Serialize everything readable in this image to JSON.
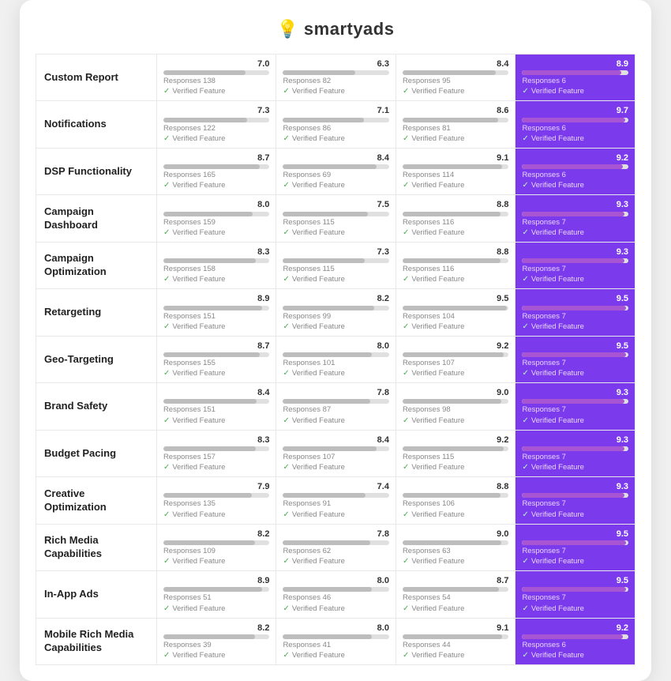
{
  "logo": {
    "text": "smartyads",
    "icon": "💡"
  },
  "rows": [
    {
      "label": "Custom Report",
      "cols": [
        {
          "score": "7.0",
          "responses": "138",
          "pct": 77
        },
        {
          "score": "6.3",
          "responses": "82",
          "pct": 68
        },
        {
          "score": "8.4",
          "responses": "95",
          "pct": 88
        },
        {
          "score": "8.9",
          "responses": "6",
          "pct": 93,
          "purple": true
        }
      ]
    },
    {
      "label": "Notifications",
      "cols": [
        {
          "score": "7.3",
          "responses": "122",
          "pct": 79
        },
        {
          "score": "7.1",
          "responses": "86",
          "pct": 76
        },
        {
          "score": "8.6",
          "responses": "81",
          "pct": 90
        },
        {
          "score": "9.7",
          "responses": "6",
          "pct": 97,
          "purple": true
        }
      ]
    },
    {
      "label": "DSP Functionality",
      "cols": [
        {
          "score": "8.7",
          "responses": "165",
          "pct": 91
        },
        {
          "score": "8.4",
          "responses": "69",
          "pct": 88
        },
        {
          "score": "9.1",
          "responses": "114",
          "pct": 94
        },
        {
          "score": "9.2",
          "responses": "6",
          "pct": 95,
          "purple": true
        }
      ]
    },
    {
      "label": "Campaign Dashboard",
      "cols": [
        {
          "score": "8.0",
          "responses": "159",
          "pct": 84
        },
        {
          "score": "7.5",
          "responses": "115",
          "pct": 80
        },
        {
          "score": "8.8",
          "responses": "116",
          "pct": 92
        },
        {
          "score": "9.3",
          "responses": "7",
          "pct": 96,
          "purple": true
        }
      ]
    },
    {
      "label": "Campaign Optimization",
      "cols": [
        {
          "score": "8.3",
          "responses": "158",
          "pct": 87
        },
        {
          "score": "7.3",
          "responses": "115",
          "pct": 77
        },
        {
          "score": "8.8",
          "responses": "116",
          "pct": 92
        },
        {
          "score": "9.3",
          "responses": "7",
          "pct": 96,
          "purple": true
        }
      ]
    },
    {
      "label": "Retargeting",
      "cols": [
        {
          "score": "8.9",
          "responses": "151",
          "pct": 93
        },
        {
          "score": "8.2",
          "responses": "99",
          "pct": 86
        },
        {
          "score": "9.5",
          "responses": "104",
          "pct": 98
        },
        {
          "score": "9.5",
          "responses": "7",
          "pct": 98,
          "purple": true
        }
      ]
    },
    {
      "label": "Geo-Targeting",
      "cols": [
        {
          "score": "8.7",
          "responses": "155",
          "pct": 91
        },
        {
          "score": "8.0",
          "responses": "101",
          "pct": 84
        },
        {
          "score": "9.2",
          "responses": "107",
          "pct": 95
        },
        {
          "score": "9.5",
          "responses": "7",
          "pct": 98,
          "purple": true
        }
      ]
    },
    {
      "label": "Brand Safety",
      "cols": [
        {
          "score": "8.4",
          "responses": "151",
          "pct": 88
        },
        {
          "score": "7.8",
          "responses": "87",
          "pct": 82
        },
        {
          "score": "9.0",
          "responses": "98",
          "pct": 93
        },
        {
          "score": "9.3",
          "responses": "7",
          "pct": 96,
          "purple": true
        }
      ]
    },
    {
      "label": "Budget Pacing",
      "cols": [
        {
          "score": "8.3",
          "responses": "157",
          "pct": 87
        },
        {
          "score": "8.4",
          "responses": "107",
          "pct": 88
        },
        {
          "score": "9.2",
          "responses": "115",
          "pct": 95
        },
        {
          "score": "9.3",
          "responses": "7",
          "pct": 96,
          "purple": true
        }
      ]
    },
    {
      "label": "Creative Optimization",
      "cols": [
        {
          "score": "7.9",
          "responses": "135",
          "pct": 83
        },
        {
          "score": "7.4",
          "responses": "91",
          "pct": 78
        },
        {
          "score": "8.8",
          "responses": "106",
          "pct": 92
        },
        {
          "score": "9.3",
          "responses": "7",
          "pct": 96,
          "purple": true
        }
      ]
    },
    {
      "label": "Rich Media Capabilities",
      "cols": [
        {
          "score": "8.2",
          "responses": "109",
          "pct": 86
        },
        {
          "score": "7.8",
          "responses": "62",
          "pct": 82
        },
        {
          "score": "9.0",
          "responses": "63",
          "pct": 93
        },
        {
          "score": "9.5",
          "responses": "7",
          "pct": 98,
          "purple": true
        }
      ]
    },
    {
      "label": "In-App Ads",
      "cols": [
        {
          "score": "8.9",
          "responses": "51",
          "pct": 93
        },
        {
          "score": "8.0",
          "responses": "46",
          "pct": 84
        },
        {
          "score": "8.7",
          "responses": "54",
          "pct": 91
        },
        {
          "score": "9.5",
          "responses": "7",
          "pct": 98,
          "purple": true
        }
      ]
    },
    {
      "label": "Mobile Rich Media Capabilities",
      "cols": [
        {
          "score": "8.2",
          "responses": "39",
          "pct": 86
        },
        {
          "score": "8.0",
          "responses": "41",
          "pct": 84
        },
        {
          "score": "9.1",
          "responses": "44",
          "pct": 94
        },
        {
          "score": "9.2",
          "responses": "6",
          "pct": 95,
          "purple": true
        }
      ]
    }
  ],
  "verified_label": "Verified Feature",
  "responses_prefix": "Responses"
}
